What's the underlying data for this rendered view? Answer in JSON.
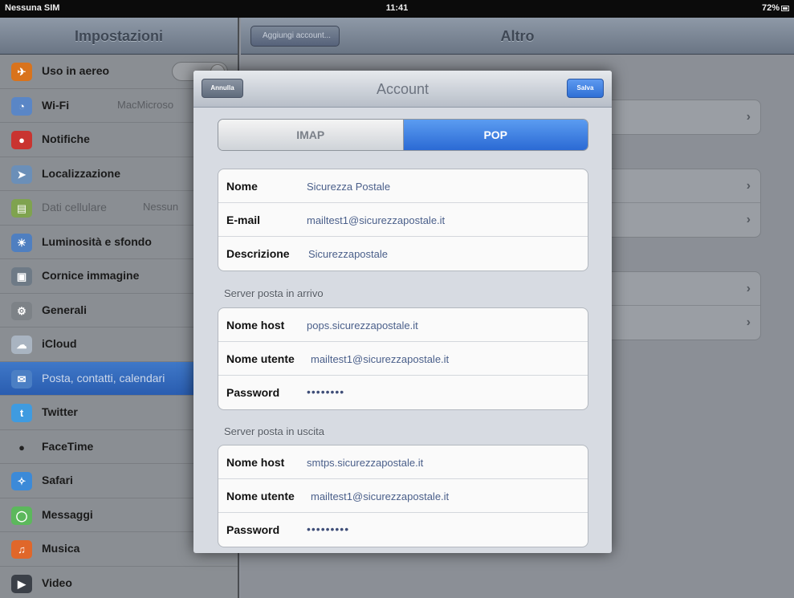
{
  "status_bar": {
    "carrier": "Nessuna SIM",
    "time": "11:41",
    "battery": "72%"
  },
  "master": {
    "title": "Impostazioni",
    "items": [
      {
        "label": "Uso in aereo",
        "icon": "airplane-icon",
        "color": "#d9731c"
      },
      {
        "label": "Wi-Fi",
        "value": "MacMicroso",
        "icon": "wifi-icon",
        "color": "#5a86c6"
      },
      {
        "label": "Notifiche",
        "icon": "notifications-icon",
        "color": "#c93430"
      },
      {
        "label": "Localizzazione",
        "icon": "location-icon",
        "color": "#6b8fb8"
      },
      {
        "label": "Dati cellulare",
        "value": "Nessun",
        "icon": "cellular-icon",
        "color": "#7fa34f"
      },
      {
        "label": "Luminosità e sfondo",
        "icon": "brightness-icon",
        "color": "#4f7fc0"
      },
      {
        "label": "Cornice immagine",
        "icon": "picture-frame-icon",
        "color": "#6e7a86"
      },
      {
        "label": "Generali",
        "icon": "gear-icon",
        "color": "#7d8287"
      },
      {
        "label": "iCloud",
        "icon": "cloud-icon",
        "color": "#a9b4c1"
      },
      {
        "label": "Posta, contatti, calendari",
        "icon": "mail-icon",
        "color": "#4b7fc4"
      },
      {
        "label": "Twitter",
        "icon": "twitter-icon",
        "color": "#3f9be0"
      },
      {
        "label": "FaceTime",
        "icon": "facetime-icon",
        "color": "#333333"
      },
      {
        "label": "Safari",
        "icon": "safari-icon",
        "color": "#3c8ad8"
      },
      {
        "label": "Messaggi",
        "icon": "messages-icon",
        "color": "#5cb85c"
      },
      {
        "label": "Musica",
        "icon": "music-icon",
        "color": "#e0672a"
      },
      {
        "label": "Video",
        "icon": "video-icon",
        "color": "#3b4048"
      }
    ]
  },
  "detail": {
    "title": "Altro",
    "back_label": "Aggiungi account..."
  },
  "sheet": {
    "title": "Account",
    "cancel_label": "Annulla",
    "save_label": "Salva",
    "segments": {
      "imap": "IMAP",
      "pop": "POP",
      "selected": "POP"
    },
    "account": {
      "name_label": "Nome",
      "name_value": "Sicurezza Postale",
      "email_label": "E-mail",
      "email_value": "mailtest1@sicurezzapostale.it",
      "desc_label": "Descrizione",
      "desc_value": "Sicurezzapostale"
    },
    "incoming": {
      "header": "Server posta in arrivo",
      "host_label": "Nome host",
      "host_value": "pops.sicurezzapostale.it",
      "user_label": "Nome utente",
      "user_value": "mailtest1@sicurezzapostale.it",
      "password_label": "Password",
      "password_value": "••••••••"
    },
    "outgoing": {
      "header": "Server posta in uscita",
      "host_label": "Nome host",
      "host_value": "smtps.sicurezzapostale.it",
      "user_label": "Nome utente",
      "user_value": "mailtest1@sicurezzapostale.it",
      "password_label": "Password",
      "password_value": "•••••••••"
    }
  }
}
